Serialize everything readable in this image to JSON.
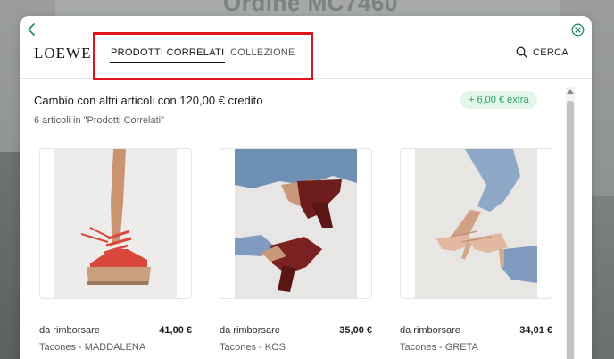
{
  "backdrop": {
    "title": "Ordine MC7460"
  },
  "modal": {
    "brand": "LOEWE",
    "tabs": [
      {
        "label": "PRODOTTI CORRELATI",
        "active": true
      },
      {
        "label": "COLLEZIONE",
        "active": false
      }
    ],
    "search_label": "CERCA",
    "heading": "Cambio con altri articoli con 120,00 € credito",
    "subheading": "6 articoli in \"Prodotti Correlati\"",
    "extra_badge": "+ 6,00 € extra",
    "products": [
      {
        "refund_label": "da rimborsare",
        "price": "41,00 €",
        "name": "Tacones - MADDALENA"
      },
      {
        "refund_label": "da rimborsare",
        "price": "35,00 €",
        "name": "Tacones - KOS"
      },
      {
        "refund_label": "da rimborsare",
        "price": "34,01 €",
        "name": "Tacones - GRETA"
      }
    ]
  },
  "colors": {
    "accent_green": "#1f8a5a",
    "badge_bg": "#e4f5ea",
    "badge_text": "#2aa45d",
    "highlight_red": "#e0161c"
  },
  "icons": {
    "back": "chevron-left-icon",
    "close": "close-circle-icon",
    "search": "search-icon"
  }
}
